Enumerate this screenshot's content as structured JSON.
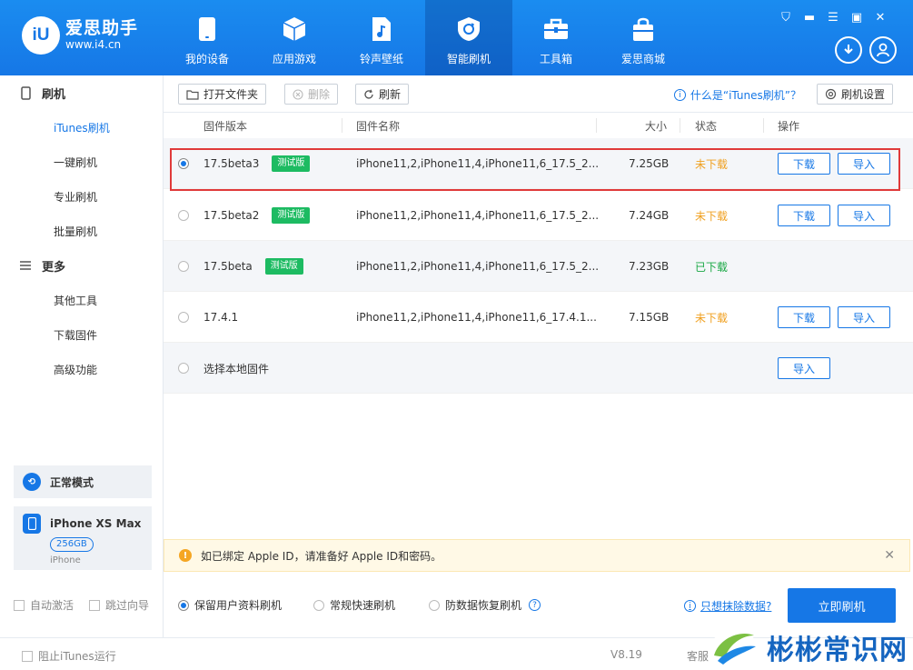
{
  "app": {
    "logo_badge": "iU",
    "logo_title": "爱思助手",
    "logo_url": "www.i4.cn"
  },
  "nav": [
    {
      "label": "我的设备",
      "icon": "phone-icon"
    },
    {
      "label": "应用游戏",
      "icon": "cube-icon"
    },
    {
      "label": "铃声壁纸",
      "icon": "music-file-icon"
    },
    {
      "label": "智能刷机",
      "icon": "refresh-shield-icon",
      "active": true
    },
    {
      "label": "工具箱",
      "icon": "toolbox-icon"
    },
    {
      "label": "爱思商城",
      "icon": "shopping-bag-icon"
    }
  ],
  "window_controls": [
    "shirt-icon",
    "minimize-icon",
    "menu-icon",
    "maximize-icon",
    "close-icon"
  ],
  "sidebar": {
    "groups": [
      {
        "label": "刷机",
        "icon": "phone-icon",
        "items": [
          {
            "label": "iTunes刷机",
            "active": true
          },
          {
            "label": "一键刷机"
          },
          {
            "label": "专业刷机"
          },
          {
            "label": "批量刷机"
          }
        ]
      },
      {
        "label": "更多",
        "icon": "menu-icon",
        "items": [
          {
            "label": "其他工具"
          },
          {
            "label": "下载固件"
          },
          {
            "label": "高级功能"
          }
        ]
      }
    ],
    "mode": "正常模式",
    "device": {
      "name": "iPhone XS Max",
      "capacity": "256GB",
      "type": "iPhone"
    },
    "auto_activate": "自动激活",
    "skip_guide": "跳过向导"
  },
  "toolbar": {
    "open_folder": "打开文件夹",
    "delete": "删除",
    "refresh": "刷新",
    "help": "什么是“iTunes刷机”？",
    "settings": "刷机设置"
  },
  "table": {
    "headers": {
      "version": "固件版本",
      "name": "固件名称",
      "size": "大小",
      "status": "状态",
      "action": "操作"
    },
    "rows": [
      {
        "version": "17.5beta3",
        "tag": "测试版",
        "name": "iPhone11,2,iPhone11,4,iPhone11,6_17.5_2...",
        "size": "7.25GB",
        "status": "未下载",
        "status_type": "not",
        "download": "下载",
        "import": "导入",
        "selected": true
      },
      {
        "version": "17.5beta2",
        "tag": "测试版",
        "name": "iPhone11,2,iPhone11,4,iPhone11,6_17.5_2...",
        "size": "7.24GB",
        "status": "未下载",
        "status_type": "not",
        "download": "下载",
        "import": "导入"
      },
      {
        "version": "17.5beta",
        "tag": "测试版",
        "name": "iPhone11,2,iPhone11,4,iPhone11,6_17.5_2...",
        "size": "7.23GB",
        "status": "已下载",
        "status_type": "done"
      },
      {
        "version": "17.4.1",
        "name": "iPhone11,2,iPhone11,4,iPhone11,6_17.4.1...",
        "size": "7.15GB",
        "status": "未下载",
        "status_type": "not",
        "download": "下载",
        "import": "导入"
      }
    ],
    "local": {
      "label": "选择本地固件",
      "import": "导入"
    }
  },
  "notice": {
    "text": "如已绑定 Apple ID，请准备好 Apple ID和密码。"
  },
  "options": {
    "keep_data": "保留用户资料刷机",
    "quick": "常规快速刷机",
    "recovery": "防数据恢复刷机",
    "erase_link": "只想抹除数据?",
    "flash_button": "立即刷机"
  },
  "statusbar": {
    "block_itunes": "阻止iTunes运行",
    "version": "V8.19",
    "service": "客服"
  },
  "watermark": {
    "text": "彬彬常识网"
  },
  "colors": {
    "brand": "#1677e6",
    "not_downloaded": "#f0a020",
    "downloaded": "#1aa845",
    "beta_tag": "#1dbb62",
    "highlight": "#e03a3a"
  }
}
